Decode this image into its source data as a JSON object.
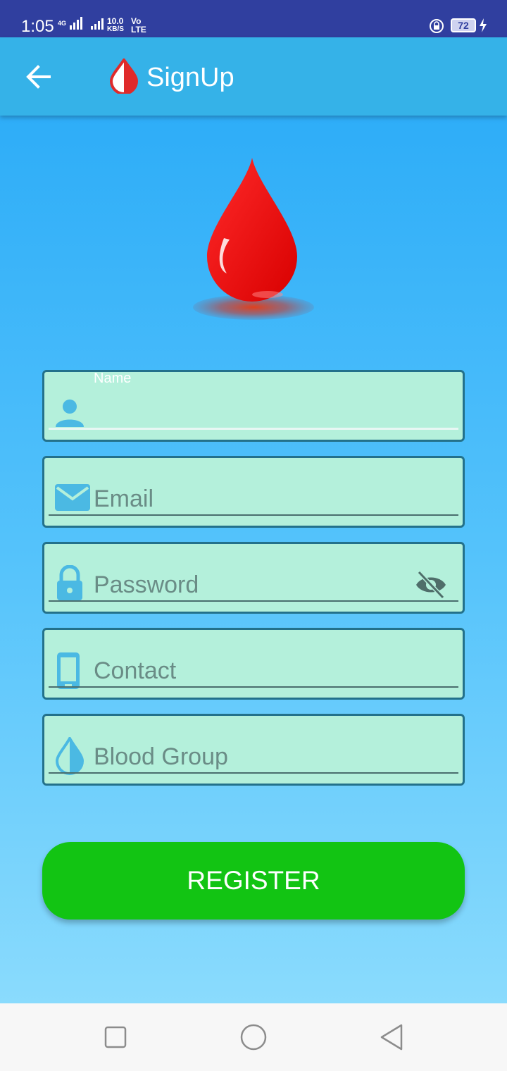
{
  "status_bar": {
    "time": "1:05",
    "network": "4G",
    "speed_value": "10.0",
    "speed_unit": "KB/S",
    "volte_top": "Vo",
    "volte_bottom": "LTE",
    "battery": "72"
  },
  "app_bar": {
    "title": "SignUp",
    "back_icon": "arrow-left-icon",
    "logo_icon": "blood-drop-icon"
  },
  "form": {
    "name": {
      "label": "Name",
      "value": "",
      "icon": "person-icon"
    },
    "email": {
      "placeholder": "Email",
      "icon": "mail-icon"
    },
    "password": {
      "placeholder": "Password",
      "icon": "lock-icon",
      "toggle_icon": "eye-off-icon"
    },
    "contact": {
      "placeholder": "Contact",
      "icon": "phone-icon"
    },
    "blood_group": {
      "placeholder": "Blood Group",
      "icon": "drop-icon"
    }
  },
  "register_label": "REGISTER",
  "colors": {
    "status_bar": "#303f9f",
    "app_bar": "#35b2e8",
    "field_bg": "#b4f0db",
    "register": "#12c413",
    "drop": "#ee0b0b"
  }
}
